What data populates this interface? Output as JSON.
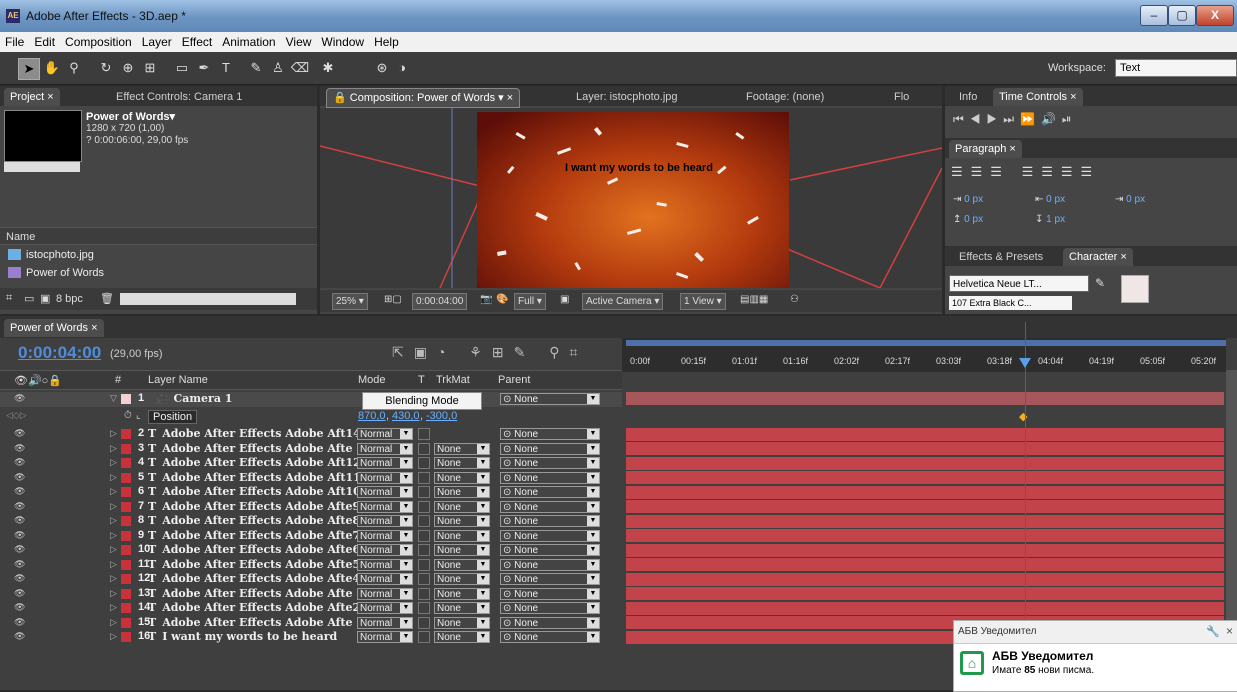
{
  "window": {
    "title": "Adobe After Effects - 3D.aep *",
    "app_icon_text": "AE",
    "minimize": "–",
    "maximize": "▢",
    "close": "X"
  },
  "menu": [
    "File",
    "Edit",
    "Composition",
    "Layer",
    "Effect",
    "Animation",
    "View",
    "Window",
    "Help"
  ],
  "workspace": {
    "label": "Workspace:",
    "value": "Text"
  },
  "project_panel": {
    "tabs": [
      "Project",
      "Effect Controls: Camera 1"
    ],
    "comp_name": "Power of Words▾",
    "comp_size": "1280 x 720 (1,00)",
    "comp_duration": "? 0:00:06:00, 29,00 fps",
    "name_header": "Name",
    "items": [
      "istocphoto.jpg",
      "Power of Words"
    ],
    "bpc": "8 bpc"
  },
  "composition_panel": {
    "tabs": [
      "Composition: Power of Words",
      "Layer: istocphoto.jpg",
      "Footage: (none)",
      "Flo"
    ],
    "viewer_text": "I want my words to be heard",
    "zoom": "25%",
    "timecode": "0:00:04:00",
    "resolution": "Full",
    "camera": "Active Camera",
    "views": "1 View"
  },
  "right_panels": {
    "info_tab": "Info",
    "time_controls_tab": "Time Controls",
    "paragraph_tab": "Paragraph",
    "indent_left": "0 px",
    "indent_right": "0 px",
    "indent_first": "0 px",
    "space_before": "0 px",
    "space_after": "1 px",
    "effects_tab": "Effects & Presets",
    "character_tab": "Character",
    "font": "Helvetica Neue LT...",
    "font_style": "107 Extra Black C..."
  },
  "timeline": {
    "tab": "Power of Words",
    "time": "0:00:04:00",
    "fps": "(29,00 fps)",
    "headers": {
      "num": "#",
      "layer_name": "Layer Name",
      "mode": "Mode",
      "t": "T",
      "trkmat": "TrkMat",
      "parent": "Parent"
    },
    "ruler": [
      "0:00f",
      "00:15f",
      "01:01f",
      "01:16f",
      "02:02f",
      "02:17f",
      "03:03f",
      "03:18f",
      "04:04f",
      "04:19f",
      "05:05f",
      "05:20f"
    ],
    "camera_row": {
      "num": "1",
      "name": "Camera 1",
      "parent": "None"
    },
    "position_row": {
      "label": "Position",
      "value_x": "870,0",
      "value_y": "430,0",
      "value_z": "-300,0"
    },
    "tooltip": "Blending Mode",
    "layers": [
      {
        "num": "2",
        "name": "Adobe After Effects Adobe Aft14",
        "mode": "Normal",
        "trkmat": "",
        "parent": "None"
      },
      {
        "num": "3",
        "name": "Adobe After Effects Adobe Afte",
        "mode": "Normal",
        "trkmat": "None",
        "parent": "None"
      },
      {
        "num": "4",
        "name": "Adobe After Effects Adobe Aft12",
        "mode": "Normal",
        "trkmat": "None",
        "parent": "None"
      },
      {
        "num": "5",
        "name": "Adobe After Effects Adobe Aft11",
        "mode": "Normal",
        "trkmat": "None",
        "parent": "None"
      },
      {
        "num": "6",
        "name": "Adobe After Effects Adobe Aft10",
        "mode": "Normal",
        "trkmat": "None",
        "parent": "None"
      },
      {
        "num": "7",
        "name": "Adobe After Effects Adobe Afte9",
        "mode": "Normal",
        "trkmat": "None",
        "parent": "None"
      },
      {
        "num": "8",
        "name": "Adobe After Effects Adobe Afte8",
        "mode": "Normal",
        "trkmat": "None",
        "parent": "None"
      },
      {
        "num": "9",
        "name": "Adobe After Effects Adobe Afte7",
        "mode": "Normal",
        "trkmat": "None",
        "parent": "None"
      },
      {
        "num": "10",
        "name": "Adobe After Effects Adobe Afte6",
        "mode": "Normal",
        "trkmat": "None",
        "parent": "None"
      },
      {
        "num": "11",
        "name": "Adobe After Effects Adobe Afte5",
        "mode": "Normal",
        "trkmat": "None",
        "parent": "None"
      },
      {
        "num": "12",
        "name": "Adobe After Effects Adobe Afte4",
        "mode": "Normal",
        "trkmat": "None",
        "parent": "None"
      },
      {
        "num": "13",
        "name": "Adobe After Effects Adobe Afte",
        "mode": "Normal",
        "trkmat": "None",
        "parent": "None"
      },
      {
        "num": "14",
        "name": "Adobe After Effects Adobe Afte2",
        "mode": "Normal",
        "trkmat": "None",
        "parent": "None"
      },
      {
        "num": "15",
        "name": "Adobe After Effects Adobe Afte",
        "mode": "Normal",
        "trkmat": "None",
        "parent": "None"
      },
      {
        "num": "16",
        "name": "I want my words to be heard",
        "mode": "Normal",
        "trkmat": "None",
        "parent": "None"
      }
    ]
  },
  "notification": {
    "header": "АБВ Уведомител",
    "title": "АБВ Уведомител",
    "msg_prefix": "Имате",
    "count": "85",
    "msg_suffix": "нови писма."
  },
  "colors": {
    "label_red": "#c8323b",
    "bar_red": "#c2444a",
    "timecode_blue": "#4f8ddb",
    "cti_red": "#e22222"
  }
}
